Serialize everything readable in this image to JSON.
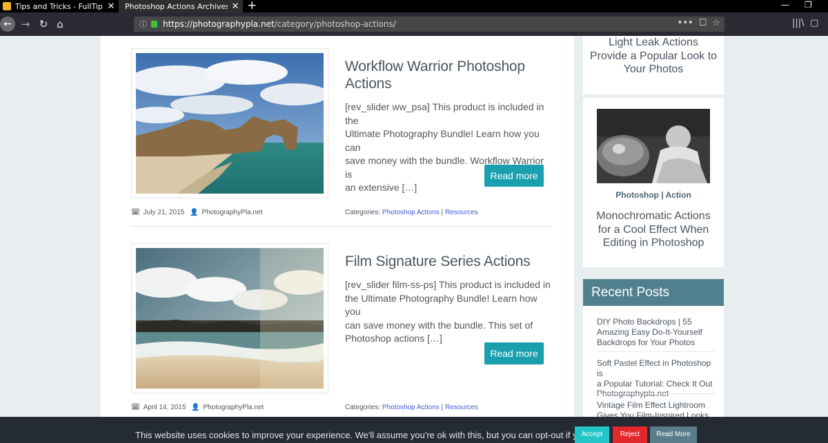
{
  "browser": {
    "tabs": [
      {
        "title": "Tips and Tricks - FullTip",
        "close": "✕"
      },
      {
        "title": "Photoshop Actions Archives - Photo",
        "close": "✕"
      }
    ],
    "new_tab": "+",
    "url_domain": "https://photographypla.net",
    "url_path": "/category/photoshop-actions/",
    "url_actions": [
      "•••",
      "☐",
      "☆"
    ],
    "library_icon": "|||\\",
    "sidebar_icon": "▢"
  },
  "posts": [
    {
      "title_line1": "Workflow Warrior Photoshop",
      "title_line2": "Actions",
      "excerpt": [
        "[rev_slider ww_psa] This product is included in the",
        "Ultimate Photography Bundle! Learn how you can",
        "save money with the bundle. Workflow Warrior is",
        "an extensive […]"
      ],
      "read_more": "Read more",
      "date": "July 21, 2015",
      "author": "PhotographyPla.net",
      "categories_label": "Categories:",
      "category1": "Photoshop Actions",
      "separator": "|",
      "category2": "Resources"
    },
    {
      "title_line1": "Film Signature Series Actions",
      "excerpt": [
        "[rev_slider film-ss-ps] This product is included in",
        "the Ultimate Photography Bundle! Learn how you",
        "can save money with the bundle. This set of",
        "Photoshop actions […]"
      ],
      "read_more": "Read more",
      "date": "April 14, 2015",
      "author": "PhotographyPla.net",
      "categories_label": "Categories:",
      "category1": "Photoshop Actions",
      "separator": "|",
      "category2": "Resources"
    }
  ],
  "sidebar": {
    "top_title": [
      "Light Leak Actions",
      "Provide a Popular Look to",
      "Your Photos"
    ],
    "cat_a": "Photoshop",
    "cat_sep": "|",
    "cat_b": "Action",
    "card_title": [
      "Monochromatic Actions",
      "for a Cool Effect When",
      "Editing in Photoshop"
    ],
    "recent_heading": "Recent Posts",
    "recent": [
      [
        "DIY Photo Backdrops | 55",
        "Amazing Easy Do-It-Yourself",
        "Backdrops for Your Photos"
      ],
      [
        "Soft Pastel Effect in Photoshop is",
        "a Popular Tutorial: Check It Out",
        "Photographypla.net"
      ],
      [
        "Vintage Film Effect Lightroom",
        "Gives You Film-Inspired Looks"
      ]
    ]
  },
  "cookie": {
    "text": "This website uses cookies to improve your experience. We'll assume you're ok with this, but you can opt-out if you wish.",
    "accept": "Accept",
    "reject": "Reject",
    "read_more": "Read More"
  },
  "colors": {
    "accent": "#1a9fae",
    "recent_header": "#50808e",
    "accept": "#23c6c8",
    "reject": "#e3282b",
    "read_more_btn": "#5b7d89"
  }
}
